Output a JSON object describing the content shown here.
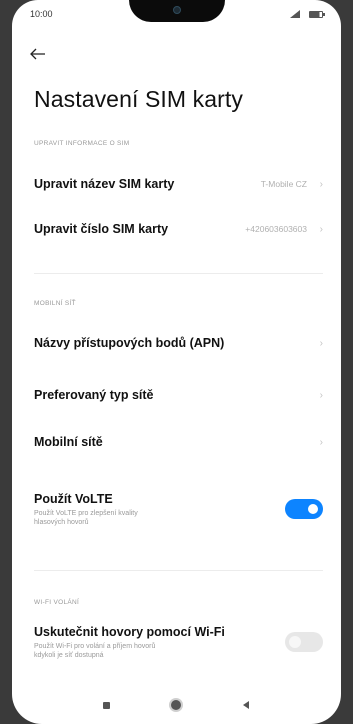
{
  "status_bar": {
    "time": "10:00",
    "signal_icon": "signal-icon",
    "battery_icon": "battery-icon"
  },
  "header": {
    "back_icon": "back-arrow-icon",
    "title": "Nastavení SIM karty"
  },
  "sections": {
    "sim_info": {
      "header": "UPRAVIT INFORMACE O SIM",
      "rows": [
        {
          "label": "Upravit název SIM karty",
          "value": "T-Mobile CZ"
        },
        {
          "label": "Upravit číslo SIM karty",
          "value": "+420603603603"
        }
      ]
    },
    "mobile_network": {
      "header": "MOBILNÍ SÍŤ",
      "rows": [
        {
          "label": "Názvy přístupových bodů (APN)"
        },
        {
          "label": "Preferovaný typ sítě"
        },
        {
          "label": "Mobilní sítě"
        }
      ],
      "volte": {
        "label": "Použít VoLTE",
        "subtitle": "Použít VoLTE pro zlepšení kvality\nhlasových hovorů",
        "enabled": true
      }
    },
    "wifi_calling": {
      "header": "WI-FI VOLÁNÍ",
      "wifi": {
        "label": "Uskutečnit hovory pomocí Wi-Fi",
        "subtitle": "Použít Wi-Fi pro volání a příjem hovorů\nkdykoli je síť dostupná",
        "enabled": false
      }
    }
  },
  "colors": {
    "accent": "#0d84ff",
    "toggle_off": "#e7e7e7",
    "section_header": "#9a9a9a"
  },
  "nav_bar": {
    "recents_icon": "square-icon",
    "home_icon": "circle-icon",
    "back_icon": "triangle-back-icon"
  }
}
